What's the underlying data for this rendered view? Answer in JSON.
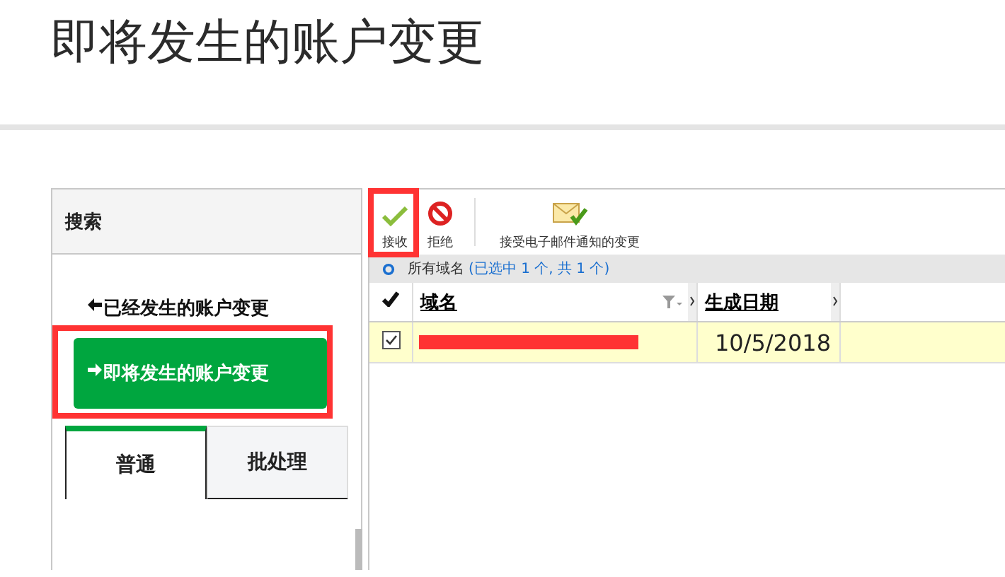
{
  "page_title": "即将发生的账户变更",
  "sidebar": {
    "header": "搜索",
    "nav_items": [
      {
        "label": "已经发生的账户变更",
        "kind": "back",
        "selected": false,
        "highlighted": false
      },
      {
        "label": "即将发生的账户变更",
        "kind": "forward",
        "selected": true,
        "highlighted": true
      }
    ],
    "tabs": [
      {
        "label": "普通",
        "selected": true
      },
      {
        "label": "批处理",
        "selected": false
      }
    ]
  },
  "toolbar": [
    {
      "label": "接收",
      "kind": "accept",
      "highlighted": true
    },
    {
      "label": "拒绝",
      "kind": "reject",
      "highlighted": false
    },
    {
      "label": "接受电子邮件通知的变更",
      "kind": "email",
      "highlighted": false
    }
  ],
  "filter": {
    "label": "所有域名",
    "count": "(已选中 1 个, 共 1 个)"
  },
  "table": {
    "columns": [
      "域名",
      "生成日期"
    ],
    "rows": [
      {
        "checked": true,
        "domain_redacted": true,
        "date": "10/5/2018"
      }
    ]
  }
}
